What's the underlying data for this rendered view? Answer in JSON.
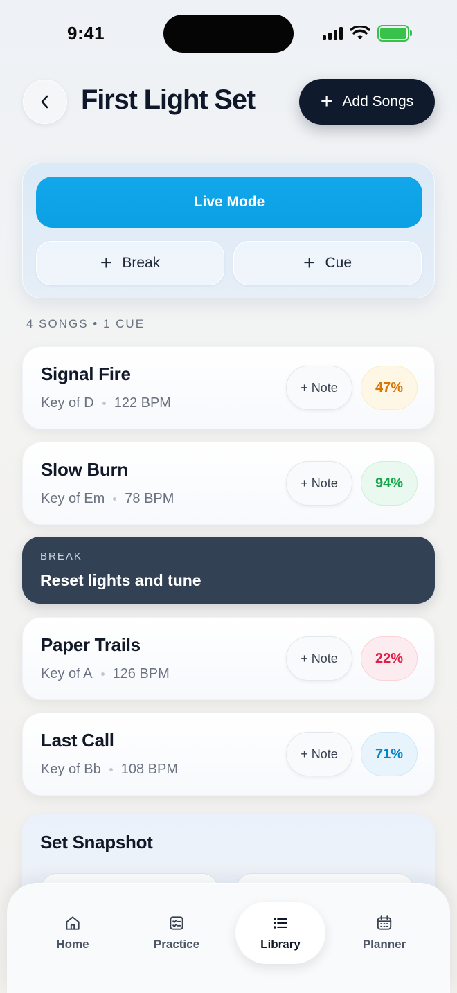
{
  "status_bar": {
    "time": "9:41"
  },
  "header": {
    "title": "First Light Set",
    "add_songs_label": "Add Songs"
  },
  "controls": {
    "live_mode_label": "Live Mode",
    "break_label": "Break",
    "cue_label": "Cue"
  },
  "summary": {
    "count_label": "4 SONGS • 1 CUE"
  },
  "setlist": [
    {
      "type": "song",
      "title": "Signal Fire",
      "key": "Key of D",
      "bpm": "122 BPM",
      "note_label": "+ Note",
      "progress": "47%",
      "progress_value": 47,
      "progress_color": "#d97706"
    },
    {
      "type": "song",
      "title": "Slow Burn",
      "key": "Key of Em",
      "bpm": "78 BPM",
      "note_label": "+ Note",
      "progress": "94%",
      "progress_value": 94,
      "progress_color": "#16a34a"
    },
    {
      "type": "break",
      "kicker": "BREAK",
      "title": "Reset lights and tune"
    },
    {
      "type": "song",
      "title": "Paper Trails",
      "key": "Key of A",
      "bpm": "126 BPM",
      "note_label": "+ Note",
      "progress": "22%",
      "progress_value": 22,
      "progress_color": "#e11d48"
    },
    {
      "type": "song",
      "title": "Last Call",
      "key": "Key of Bb",
      "bpm": "108 BPM",
      "note_label": "+ Note",
      "progress": "71%",
      "progress_value": 71,
      "progress_color": "#0284c7"
    }
  ],
  "snapshot": {
    "title": "Set Snapshot"
  },
  "nav": {
    "items": [
      {
        "label": "Home",
        "icon": "home-icon"
      },
      {
        "label": "Practice",
        "icon": "checklist-icon"
      },
      {
        "label": "Library",
        "icon": "list-icon",
        "active": true
      },
      {
        "label": "Planner",
        "icon": "calendar-icon"
      }
    ]
  },
  "colors": {
    "accent": "#0ea5e9",
    "dark": "#0f1b2d",
    "break_bg": "#334155"
  }
}
